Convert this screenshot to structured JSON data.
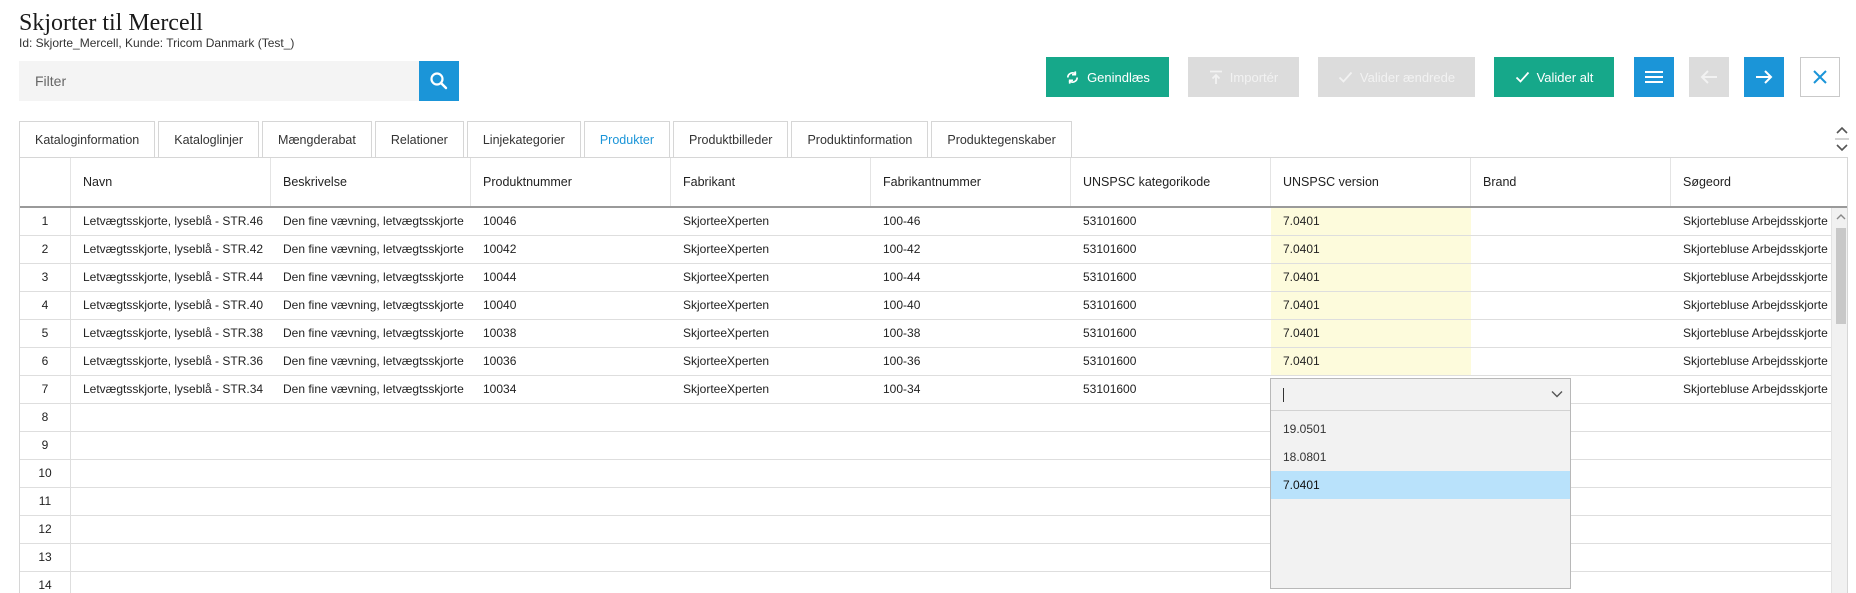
{
  "header": {
    "title": "Skjorter til Mercell",
    "subtitle": "Id: Skjorte_Mercell, Kunde: Tricom Danmark (Test_)"
  },
  "filter": {
    "placeholder": "Filter"
  },
  "toolbar": {
    "reload_label": "Genindlæs",
    "import_label": "Importér",
    "validate_changed_label": "Valider ændrede",
    "validate_all_label": "Valider alt"
  },
  "tabs": [
    {
      "label": "Kataloginformation"
    },
    {
      "label": "Kataloglinjer"
    },
    {
      "label": "Mængderabat"
    },
    {
      "label": "Relationer"
    },
    {
      "label": "Linjekategorier"
    },
    {
      "label": "Produkter"
    },
    {
      "label": "Produktbilleder"
    },
    {
      "label": "Produktinformation"
    },
    {
      "label": "Produktegenskaber"
    }
  ],
  "active_tab": "Produkter",
  "table": {
    "columns": [
      "Navn",
      "Beskrivelse",
      "Produktnummer",
      "Fabrikant",
      "Fabrikantnummer",
      "UNSPSC kategorikode",
      "UNSPSC version",
      "Brand",
      "Søgeord"
    ],
    "row_numbers": [
      "1",
      "2",
      "3",
      "4",
      "5",
      "6",
      "7",
      "8",
      "9",
      "10",
      "11",
      "12",
      "13",
      "14"
    ],
    "rows": [
      {
        "navn": "Letvægtsskjorte, lyseblå - STR.46",
        "beskrivelse": "Den fine vævning, letvægtsskjorte",
        "produktnummer": "10046",
        "fabrikant": "SkjorteeXperten",
        "fabrikantnummer": "100-46",
        "kategorikode": "53101600",
        "version": "7.0401",
        "brand": "",
        "soegeord": "Skjortebluse Arbejdsskjorte"
      },
      {
        "navn": "Letvægtsskjorte, lyseblå - STR.42",
        "beskrivelse": "Den fine vævning, letvægtsskjorte",
        "produktnummer": "10042",
        "fabrikant": "SkjorteeXperten",
        "fabrikantnummer": "100-42",
        "kategorikode": "53101600",
        "version": "7.0401",
        "brand": "",
        "soegeord": "Skjortebluse Arbejdsskjorte"
      },
      {
        "navn": "Letvægtsskjorte, lyseblå - STR.44",
        "beskrivelse": "Den fine vævning, letvægtsskjorte",
        "produktnummer": "10044",
        "fabrikant": "SkjorteeXperten",
        "fabrikantnummer": "100-44",
        "kategorikode": "53101600",
        "version": "7.0401",
        "brand": "",
        "soegeord": "Skjortebluse Arbejdsskjorte"
      },
      {
        "navn": "Letvægtsskjorte, lyseblå - STR.40",
        "beskrivelse": "Den fine vævning, letvægtsskjorte",
        "produktnummer": "10040",
        "fabrikant": "SkjorteeXperten",
        "fabrikantnummer": "100-40",
        "kategorikode": "53101600",
        "version": "7.0401",
        "brand": "",
        "soegeord": "Skjortebluse Arbejdsskjorte"
      },
      {
        "navn": "Letvægtsskjorte, lyseblå - STR.38",
        "beskrivelse": "Den fine vævning, letvægtsskjorte",
        "produktnummer": "10038",
        "fabrikant": "SkjorteeXperten",
        "fabrikantnummer": "100-38",
        "kategorikode": "53101600",
        "version": "7.0401",
        "brand": "",
        "soegeord": "Skjortebluse Arbejdsskjorte"
      },
      {
        "navn": "Letvægtsskjorte, lyseblå - STR.36",
        "beskrivelse": "Den fine vævning, letvægtsskjorte",
        "produktnummer": "10036",
        "fabrikant": "SkjorteeXperten",
        "fabrikantnummer": "100-36",
        "kategorikode": "53101600",
        "version": "7.0401",
        "brand": "",
        "soegeord": "Skjortebluse Arbejdsskjorte"
      },
      {
        "navn": "Letvægtsskjorte, lyseblå - STR.34",
        "beskrivelse": "Den fine vævning, letvægtsskjorte",
        "produktnummer": "10034",
        "fabrikant": "SkjorteeXperten",
        "fabrikantnummer": "100-34",
        "kategorikode": "53101600",
        "version": "",
        "brand": "",
        "soegeord": "Skjortebluse Arbejdsskjorte"
      }
    ]
  },
  "dropdown": {
    "value": "",
    "options": [
      "19.0501",
      "18.0801",
      "7.0401"
    ],
    "selected": "7.0401"
  },
  "colors": {
    "primary_blue": "#1b95d8",
    "green": "#16a88a",
    "disabled_grey": "#dcdcdc",
    "edited_cell": "#fdfbdc",
    "option_selected": "#b9e2fb"
  }
}
